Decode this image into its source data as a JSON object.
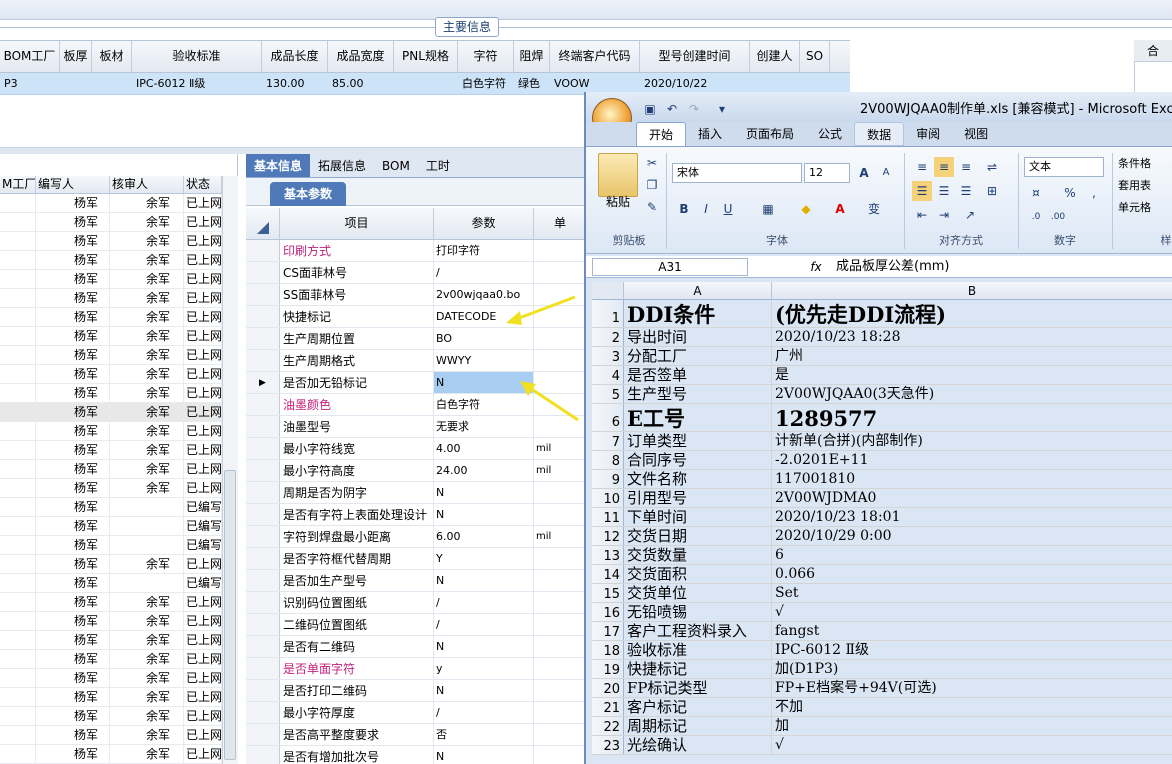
{
  "main_group_title": "主要信息",
  "grid": {
    "headers": [
      "BOM工厂",
      "板厚",
      "板材",
      "验收标准",
      "成品长度",
      "成品宽度",
      "PNL规格",
      "字符",
      "阻焊",
      "终端客户代码",
      "型号创建时间",
      "创建人",
      "SO"
    ],
    "row": [
      "P3",
      "",
      "",
      "IPC-6012 Ⅱ级",
      "130.00",
      "85.00",
      "",
      "白色字符",
      "绿色",
      "VOOW",
      "2020/10/22",
      "",
      ""
    ],
    "right_header": "合"
  },
  "left_list": {
    "headers": [
      "M工厂",
      "编写人",
      "核审人",
      "状态"
    ],
    "rows": [
      [
        "",
        "杨军",
        "余军",
        "已上网"
      ],
      [
        "",
        "杨军",
        "余军",
        "已上网"
      ],
      [
        "",
        "杨军",
        "余军",
        "已上网"
      ],
      [
        "",
        "杨军",
        "余军",
        "已上网"
      ],
      [
        "",
        "杨军",
        "余军",
        "已上网"
      ],
      [
        "",
        "杨军",
        "余军",
        "已上网"
      ],
      [
        "",
        "杨军",
        "余军",
        "已上网"
      ],
      [
        "",
        "杨军",
        "余军",
        "已上网"
      ],
      [
        "",
        "杨军",
        "余军",
        "已上网"
      ],
      [
        "",
        "杨军",
        "余军",
        "已上网"
      ],
      [
        "",
        "杨军",
        "余军",
        "已上网"
      ],
      [
        "",
        "杨军",
        "余军",
        "已上网"
      ],
      [
        "",
        "杨军",
        "余军",
        "已上网"
      ],
      [
        "",
        "杨军",
        "余军",
        "已上网"
      ],
      [
        "",
        "杨军",
        "余军",
        "已上网"
      ],
      [
        "",
        "杨军",
        "余军",
        "已上网"
      ],
      [
        "",
        "杨军",
        "",
        "已编写"
      ],
      [
        "",
        "杨军",
        "",
        "已编写"
      ],
      [
        "",
        "杨军",
        "",
        "已编写"
      ],
      [
        "",
        "杨军",
        "余军",
        "已上网"
      ],
      [
        "",
        "杨军",
        "",
        "已编写"
      ],
      [
        "",
        "杨军",
        "余军",
        "已上网"
      ],
      [
        "",
        "杨军",
        "余军",
        "已上网"
      ],
      [
        "",
        "杨军",
        "余军",
        "已上网"
      ],
      [
        "",
        "杨军",
        "余军",
        "已上网"
      ],
      [
        "",
        "杨军",
        "余军",
        "已上网"
      ],
      [
        "",
        "杨军",
        "余军",
        "已上网"
      ],
      [
        "",
        "杨军",
        "余军",
        "已上网"
      ],
      [
        "",
        "杨军",
        "余军",
        "已上网"
      ],
      [
        "",
        "杨军",
        "余军",
        "已上网"
      ]
    ]
  },
  "tabs": [
    "基本信息",
    "拓展信息",
    "BOM",
    "工时"
  ],
  "subtab": "基本参数",
  "param_headers": [
    "项目",
    "参数",
    "单"
  ],
  "params": [
    {
      "name": "印刷方式",
      "value": "打印字符",
      "unit": "",
      "pink": true
    },
    {
      "name": "CS面菲林号",
      "value": "/",
      "unit": "",
      "pink": false
    },
    {
      "name": "SS面菲林号",
      "value": "2v00wjqaa0.bo",
      "unit": "",
      "pink": false
    },
    {
      "name": "快捷标记",
      "value": "DATECODE",
      "unit": "",
      "pink": false
    },
    {
      "name": "生产周期位置",
      "value": "BO",
      "unit": "",
      "pink": false
    },
    {
      "name": "生产周期格式",
      "value": "WWYY",
      "unit": "",
      "pink": false
    },
    {
      "name": "是否加无铅标记",
      "value": "N",
      "unit": "",
      "pink": false
    },
    {
      "name": "油墨颜色",
      "value": "白色字符",
      "unit": "",
      "pink": true
    },
    {
      "name": "油墨型号",
      "value": "无要求",
      "unit": "",
      "pink": false
    },
    {
      "name": "最小字符线宽",
      "value": "4.00",
      "unit": "mil",
      "pink": false
    },
    {
      "name": "最小字符高度",
      "value": "24.00",
      "unit": "mil",
      "pink": false
    },
    {
      "name": "周期是否为阴字",
      "value": "N",
      "unit": "",
      "pink": false
    },
    {
      "name": "是否有字符上表面处理设计",
      "value": "N",
      "unit": "",
      "pink": false
    },
    {
      "name": "字符到焊盘最小距离",
      "value": "6.00",
      "unit": "mil",
      "pink": false
    },
    {
      "name": "是否字符框代替周期",
      "value": "Y",
      "unit": "",
      "pink": false
    },
    {
      "name": "是否加生产型号",
      "value": "N",
      "unit": "",
      "pink": false
    },
    {
      "name": "识别码位置图纸",
      "value": "/",
      "unit": "",
      "pink": false
    },
    {
      "name": "二维码位置图纸",
      "value": "/",
      "unit": "",
      "pink": false
    },
    {
      "name": "是否有二维码",
      "value": "N",
      "unit": "",
      "pink": false
    },
    {
      "name": "是否单面字符",
      "value": "y",
      "unit": "",
      "pink": true
    },
    {
      "name": "是否打印二维码",
      "value": "N",
      "unit": "",
      "pink": false
    },
    {
      "name": "最小字符厚度",
      "value": "/",
      "unit": "",
      "pink": false
    },
    {
      "name": "是否高平整度要求",
      "value": "否",
      "unit": "",
      "pink": false
    },
    {
      "name": "是否有增加批次号",
      "value": "N",
      "unit": "",
      "pink": false
    }
  ],
  "excel": {
    "title": "2V00WJQAA0制作单.xls [兼容模式] - Microsoft Excel",
    "ribbon_tabs": [
      "开始",
      "插入",
      "页面布局",
      "公式",
      "数据",
      "审阅",
      "视图"
    ],
    "paste_label": "粘贴",
    "font_name": "宋体",
    "font_size": "12",
    "number_format": "文本",
    "right_buttons": [
      "条件格",
      "套用表",
      "单元格"
    ],
    "group_labels": [
      "剪贴板",
      "字体",
      "对齐方式",
      "数字",
      "样"
    ],
    "name_box": "A31",
    "fx": "fx",
    "formula": "成品板厚公差(mm)",
    "columns": [
      "A",
      "B"
    ],
    "rows": [
      {
        "n": "1",
        "a": "DDI条件",
        "b": "(优先走DDI流程)",
        "big": true
      },
      {
        "n": "2",
        "a": "导出时间",
        "b": "2020/10/23 18:28"
      },
      {
        "n": "3",
        "a": "分配工厂",
        "b": "广州"
      },
      {
        "n": "4",
        "a": "是否签单",
        "b": "是"
      },
      {
        "n": "5",
        "a": "生产型号",
        "b": "2V00WJQAA0(3天急件)"
      },
      {
        "n": "6",
        "a": "E工号",
        "b": "1289577",
        "big": true
      },
      {
        "n": "7",
        "a": "订单类型",
        "b": "计新单(合拼)(内部制作)"
      },
      {
        "n": "8",
        "a": "合同序号",
        "b": "-2.0201E+11"
      },
      {
        "n": "9",
        "a": "文件名称",
        "b": "117001810"
      },
      {
        "n": "10",
        "a": "引用型号",
        "b": "2V00WJDMA0"
      },
      {
        "n": "11",
        "a": "下单时间",
        "b": "2020/10/23 18:01"
      },
      {
        "n": "12",
        "a": "交货日期",
        "b": "2020/10/29 0:00"
      },
      {
        "n": "13",
        "a": "交货数量",
        "b": "6"
      },
      {
        "n": "14",
        "a": "交货面积",
        "b": "0.066"
      },
      {
        "n": "15",
        "a": "交货单位",
        "b": "Set"
      },
      {
        "n": "16",
        "a": "无铅喷锡",
        "b": "√"
      },
      {
        "n": "17",
        "a": "客户工程资料录入",
        "b": "fangst"
      },
      {
        "n": "18",
        "a": "验收标准",
        "b": "IPC-6012 Ⅱ级"
      },
      {
        "n": "19",
        "a": "快捷标记",
        "b": "加(D1P3)"
      },
      {
        "n": "20",
        "a": "FP标记类型",
        "b": "FP+E档案号+94V(可选)"
      },
      {
        "n": "21",
        "a": "客户标记",
        "b": "不加"
      },
      {
        "n": "22",
        "a": "周期标记",
        "b": "加"
      },
      {
        "n": "23",
        "a": "光绘确认",
        "b": "√"
      }
    ]
  },
  "colors": {
    "accent": "#4f79b8",
    "selection": "#cde3f8",
    "highlight": "#a8cdf0",
    "arrow": "#f0e020",
    "pink": "#c0207a"
  }
}
